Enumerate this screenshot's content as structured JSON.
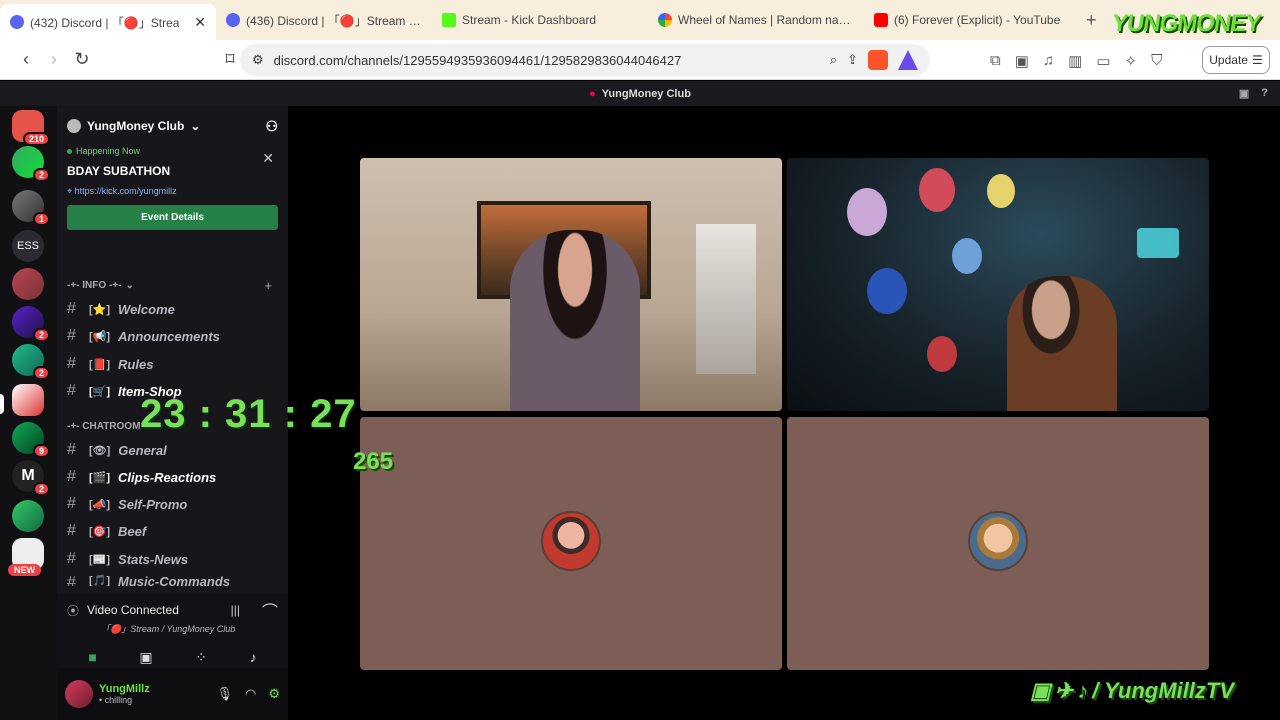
{
  "browser": {
    "tabs": [
      {
        "label": "(432) Discord | 「🔴」Strea",
        "icon": "discord-icon",
        "color": "#5865f2",
        "active": true
      },
      {
        "label": "(436) Discord | 「🔴」Stream | Yun",
        "icon": "discord-icon",
        "color": "#5865f2",
        "active": false
      },
      {
        "label": "Stream - Kick Dashboard",
        "icon": "kick-icon",
        "color": "#53fc18",
        "active": false
      },
      {
        "label": "Wheel of Names | Random name",
        "icon": "wheel-icon",
        "color": "#e44",
        "active": false
      },
      {
        "label": "(6) Forever (Explicit) - YouTube",
        "icon": "youtube-icon",
        "color": "#ff0000",
        "active": false
      }
    ],
    "url": "discord.com/channels/1295594935936094461/1295829836044046427",
    "update_label": "Update",
    "overlay_logo": "YUNGMONEY"
  },
  "discord": {
    "window_title": "YungMoney Club",
    "server_name": "YungMoney Club",
    "event": {
      "status": "Happening Now",
      "title": "BDAY SUBATHON",
      "link": "https://kick.com/yungmillz",
      "button": "Event Details"
    },
    "categories": [
      {
        "label": "-+- INFO -+-"
      },
      {
        "label": "-+- CHATROOM"
      }
    ],
    "channels": [
      {
        "label": "Welcome",
        "emoji": "[⭐]"
      },
      {
        "label": "Announcements",
        "emoji": "[📢]"
      },
      {
        "label": "Rules",
        "emoji": "[📕]"
      },
      {
        "label": "Item-Shop",
        "emoji": "[🛒]"
      },
      {
        "label": "General",
        "emoji": "[👁]"
      },
      {
        "label": "Clips-Reactions",
        "emoji": "[🎬]"
      },
      {
        "label": "Self-Promo",
        "emoji": "[📣]"
      },
      {
        "label": "Beef",
        "emoji": "[🎯]"
      },
      {
        "label": "Stats-News",
        "emoji": "[📰]"
      },
      {
        "label": "Music-Commands",
        "emoji": "[🎵]"
      }
    ],
    "servers": [
      {
        "badge": "210"
      },
      {
        "badge": "2"
      },
      {
        "badge": "1"
      },
      {
        "label": "ESS"
      },
      {},
      {
        "badge": "2"
      },
      {
        "badge": "2"
      },
      {},
      {
        "badge": "9"
      },
      {
        "badge": "2"
      },
      {},
      {}
    ],
    "new_label": "NEW",
    "voice": {
      "status": "Video Connected",
      "channel": "「🔴」Stream / YungMoney Club"
    },
    "user": {
      "name": "YungMillz",
      "status": "• chilling"
    }
  },
  "overlay": {
    "timer": "23 : 31 : 27",
    "counter": "265",
    "social": "/ YungMillzTV"
  }
}
